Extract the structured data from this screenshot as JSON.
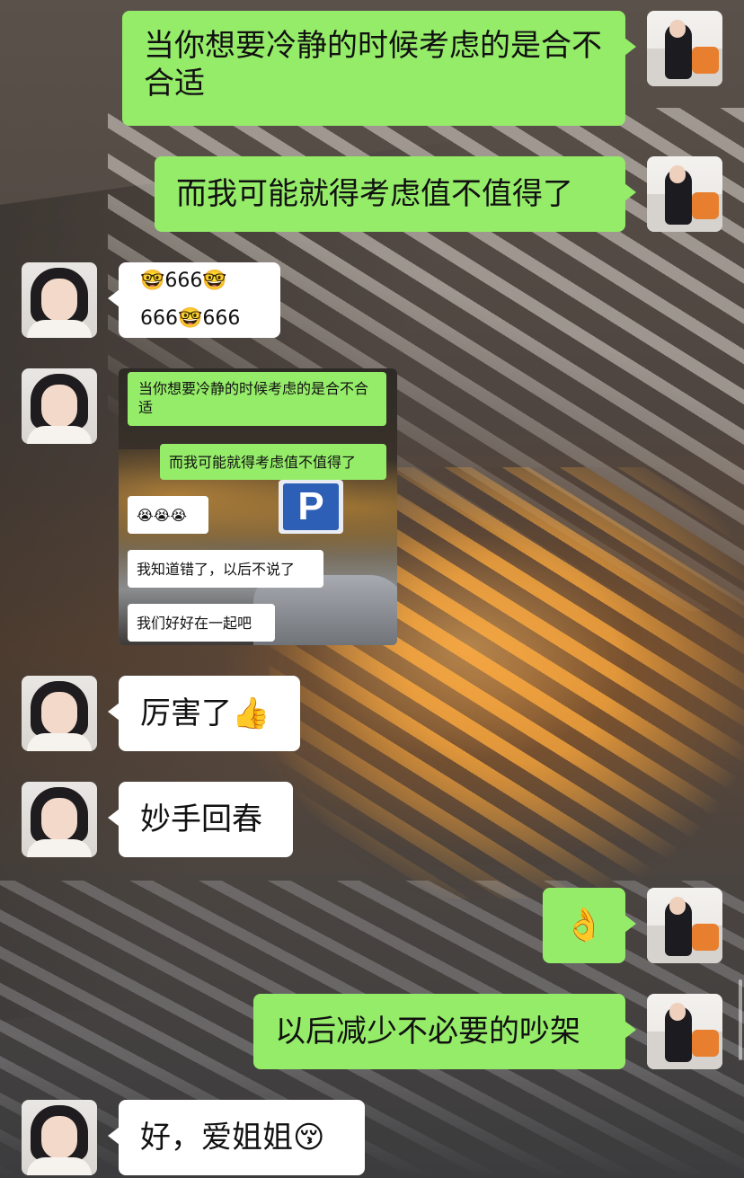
{
  "messages": [
    {
      "side": "right",
      "text": "当你想要冷静的时候考虑的是合不合适"
    },
    {
      "side": "right",
      "text": "而我可能就得考虑值不值得了"
    },
    {
      "side": "left",
      "text": "🤓666🤓666🤓666"
    },
    {
      "side": "left",
      "type": "image",
      "embedded": {
        "sign_text": "P",
        "messages": [
          {
            "side": "right",
            "text": "当你想要冷静的时候考虑的是合不合适"
          },
          {
            "side": "right",
            "text": "而我可能就得考虑值不值得了"
          },
          {
            "side": "left",
            "text": "😭😭😭"
          },
          {
            "side": "left",
            "text": "我知道错了，以后不说了"
          },
          {
            "side": "left",
            "text": "我们好好在一起吧"
          }
        ]
      }
    },
    {
      "side": "left",
      "text": "厉害了👍"
    },
    {
      "side": "left",
      "text": "妙手回春"
    },
    {
      "side": "right",
      "text": "👌"
    },
    {
      "side": "right",
      "text": "以后减少不必要的吵架"
    },
    {
      "side": "left",
      "text": "好，爱姐姐😚"
    }
  ],
  "icons": {
    "left_avatar": "avatar-girl-icon",
    "right_avatar": "avatar-woman-sofa-icon"
  },
  "colors": {
    "outgoing_bubble": "#95ec69",
    "incoming_bubble": "#ffffff"
  }
}
